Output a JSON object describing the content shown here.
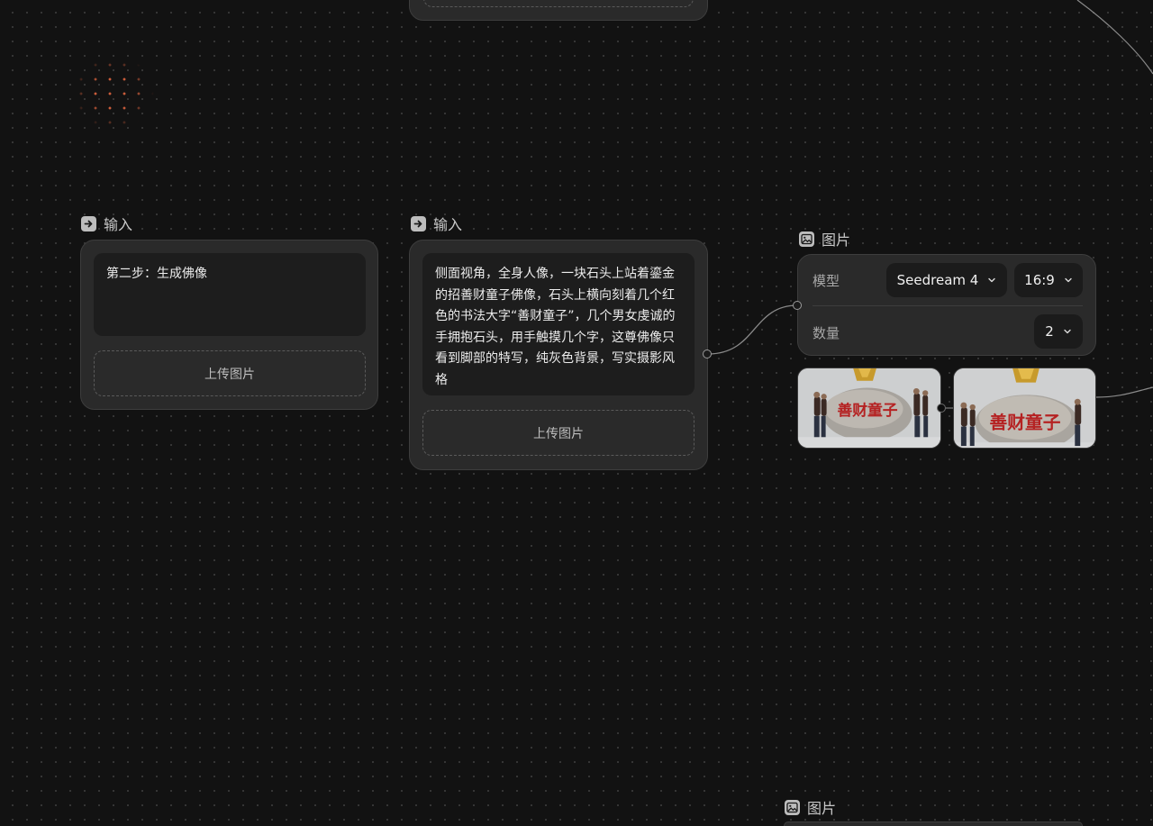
{
  "nodes": {
    "input1": {
      "title": "输入",
      "text": "第二步：生成佛像",
      "upload_label": "上传图片"
    },
    "input2": {
      "title": "输入",
      "text": "侧面视角，全身人像，一块石头上站着鎏金的招善财童子佛像，石头上横向刻着几个红色的书法大字“善财童子”，几个男女虔诚的手拥抱石头，用手触摸几个字，这尊佛像只看到脚部的特写，纯灰色背景，写实摄影风格",
      "upload_label": "上传图片"
    },
    "image1": {
      "title": "图片",
      "model_label": "模型",
      "model_value": "Seedream 4",
      "ratio_value": "16:9",
      "count_label": "数量",
      "count_value": "2",
      "thumbnails": [
        {
          "caption": "善财童子"
        },
        {
          "caption": "善财童子"
        }
      ]
    },
    "image2": {
      "title": "图片"
    }
  },
  "colors": {
    "canvas_bg": "#121212",
    "card_bg": "#2a2a2a",
    "accent_dots": "#e0653f",
    "carved_text": "#b52222"
  }
}
